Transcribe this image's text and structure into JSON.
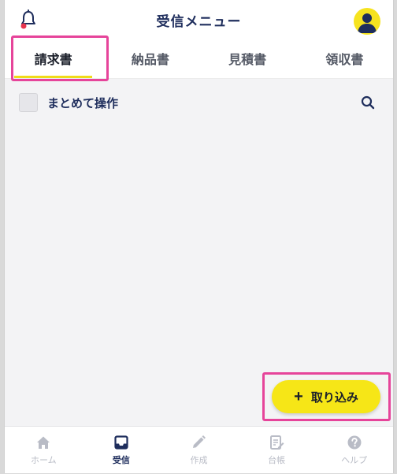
{
  "header": {
    "title": "受信メニュー",
    "left_icon": "bell-icon",
    "right_icon": "user-avatar-icon"
  },
  "tabs": [
    {
      "label": "請求書",
      "active": true
    },
    {
      "label": "納品書",
      "active": false
    },
    {
      "label": "見積書",
      "active": false
    },
    {
      "label": "領収書",
      "active": false
    }
  ],
  "toolbar": {
    "bulk_label": "まとめて操作",
    "search_icon": "search-icon"
  },
  "import_button": {
    "plus": "+",
    "label": "取り込み"
  },
  "bottom_nav": [
    {
      "label": "ホーム",
      "icon": "home-icon",
      "active": false
    },
    {
      "label": "受信",
      "icon": "inbox-icon",
      "active": true
    },
    {
      "label": "作成",
      "icon": "pencil-icon",
      "active": false
    },
    {
      "label": "台帳",
      "icon": "ledger-icon",
      "active": false
    },
    {
      "label": "ヘルプ",
      "icon": "help-icon",
      "active": false
    }
  ],
  "colors": {
    "accent_yellow": "#f6e617",
    "navy": "#1e2d5c",
    "highlight_pink": "#e6449a",
    "notification_dot": "#e8344e"
  }
}
